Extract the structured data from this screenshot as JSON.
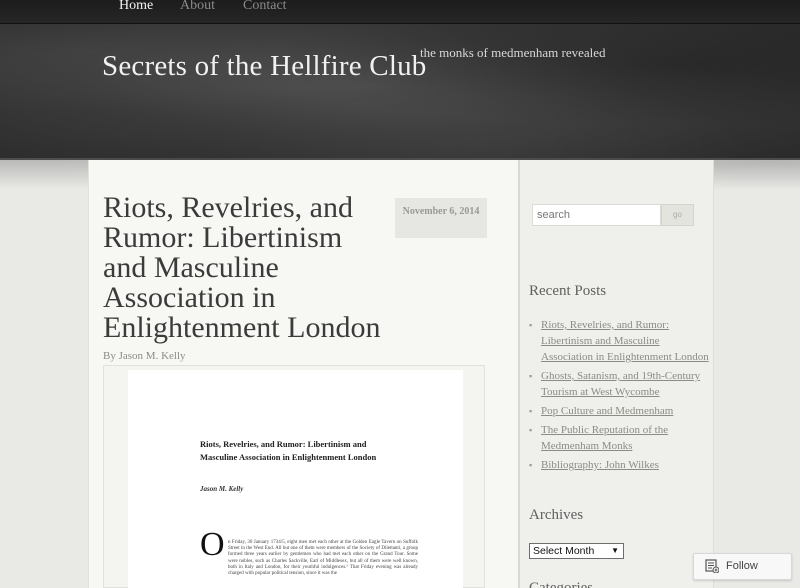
{
  "nav": {
    "items": [
      {
        "label": "Home"
      },
      {
        "label": "About"
      },
      {
        "label": "Contact"
      }
    ]
  },
  "header": {
    "title": "Secrets of the Hellfire Club",
    "tagline": "the monks of medmenham revealed"
  },
  "post": {
    "title": "Riots, Revelries, and Rumor: Libertinism and Masculine Association in Enlightenment London",
    "date": "November 6, 2014",
    "byline_prefix": "By",
    "author": "Jason M. Kelly"
  },
  "document_image": {
    "title": "Riots, Revelries, and Rumor: Libertinism and Masculine Association in Enlightenment London",
    "author": "Jason M. Kelly",
    "dropcap": "O",
    "body_text": "n Friday, 30 January 1734/5, eight men met each other at the Golden Eagle Tavern on Suffolk Street in the West End. All but one of them were members of the Society of Dilettanti, a group formed three years earlier by gentlemen who had met each other on the Grand Tour. Some were nobles, such as Charles Sackville, Earl of Middlesex, but all of them were well known, both in Italy and London, for their youthful indulgences.¹ That Friday evening was already charged with popular political tension, since it was the"
  },
  "sidebar": {
    "search": {
      "placeholder": "search",
      "button_label": "go"
    },
    "recent_posts": {
      "title": "Recent Posts",
      "items": [
        {
          "label": "Riots, Revelries, and Rumor: Libertinism and Masculine Association in Enlightenment London"
        },
        {
          "label": "Ghosts, Satanism, and 19th-Century Tourism at West Wycombe"
        },
        {
          "label": "Pop Culture and Medmenham"
        },
        {
          "label": "The Public Reputation of the Medmenham Monks"
        },
        {
          "label": "Bibliography: John Wilkes"
        }
      ]
    },
    "archives": {
      "title": "Archives",
      "select_value": "Select Month"
    },
    "categories": {
      "title": "Categories"
    }
  },
  "follow": {
    "label": "Follow"
  }
}
